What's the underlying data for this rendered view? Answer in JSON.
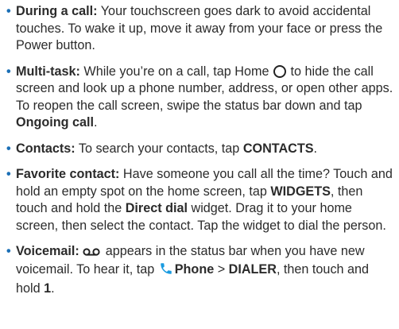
{
  "items": [
    {
      "term": "During a call:",
      "text": " Your touchscreen goes dark to avoid accidental touches. To wake it up, move it away from your face or press the Power button."
    },
    {
      "term": "Multi-task:",
      "t1": " While you’re on a call, tap Home ",
      "t2": " to hide the call screen and look up a phone number, address, or open other apps. To reopen the call screen, swipe the status bar down and tap ",
      "ui1": "Ongoing call",
      "t3": "."
    },
    {
      "term": "Contacts:",
      "t1": " To search your contacts, tap ",
      "ui1": "CONTACTS",
      "t2": "."
    },
    {
      "term": "Favorite contact:",
      "t1": " Have someone you call all the time? Touch and hold an empty spot on the home screen, tap ",
      "ui1": "WIDGETS",
      "t2": ", then touch and hold the ",
      "ui2": "Direct dial",
      "t3": " widget. Drag it to your home screen, then select the contact. Tap the widget to dial the person."
    },
    {
      "term": "Voicemail:",
      "t1": " appears in the status bar when you have new voicemail. To hear it, tap ",
      "ui1": "Phone",
      "t2": " > ",
      "ui2": "DIALER",
      "t3": ", then touch and hold ",
      "ui3": "1",
      "t4": "."
    }
  ],
  "icons": {
    "home": "home-circle-icon",
    "voicemail": "voicemail-icon",
    "phone": "phone-icon"
  },
  "colors": {
    "bullet": "#1b6fb6",
    "phone_icon": "#1a9be0"
  }
}
